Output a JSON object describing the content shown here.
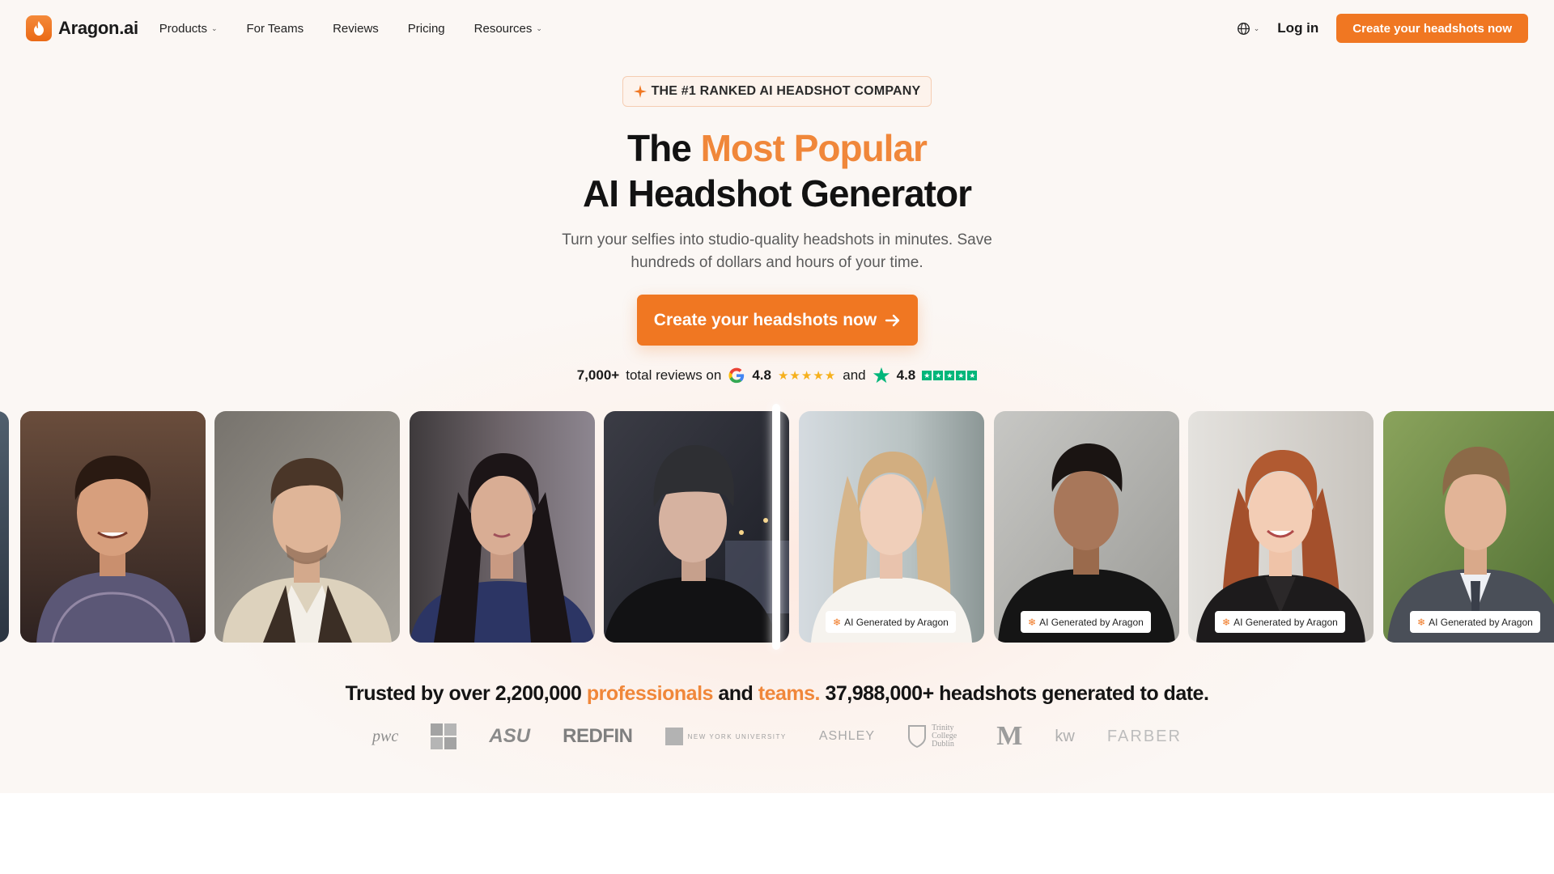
{
  "nav": {
    "logo_text": "Aragon.ai",
    "links": [
      {
        "label": "Products",
        "dropdown": true
      },
      {
        "label": "For Teams",
        "dropdown": false
      },
      {
        "label": "Reviews",
        "dropdown": false
      },
      {
        "label": "Pricing",
        "dropdown": false
      },
      {
        "label": "Resources",
        "dropdown": true
      }
    ],
    "login_label": "Log in",
    "cta_label": "Create your headshots now"
  },
  "hero": {
    "badge": "THE #1 RANKED AI HEADSHOT COMPANY",
    "title_part1": "The ",
    "title_accent": "Most Popular",
    "title_line2": "AI Headshot Generator",
    "subtitle": "Turn your selfies into studio-quality headshots in minutes. Save hundreds of dollars and hours of your time.",
    "cta_label": "Create your headshots now"
  },
  "reviews": {
    "count": "7,000+",
    "text": "total reviews on",
    "google_rating": "4.8",
    "and": "and",
    "trustpilot_rating": "4.8"
  },
  "carousel": {
    "ai_tag": "AI Generated by Aragon",
    "before_count": 4,
    "after_count": 4
  },
  "trust": {
    "prefix": "Trusted by over 2,200,000 ",
    "professionals": "professionals",
    "and": " and ",
    "teams": "teams.",
    "suffix": " 37,988,000+ headshots generated to date."
  },
  "brands": [
    "pwc",
    "REDFIN",
    "NEW YORK UNIVERSITY",
    "ASHLEY",
    "Trinity College Dublin",
    "FARBER"
  ],
  "colors": {
    "accent": "#f07722",
    "accent_light": "#f0873a",
    "google_star": "#f6b01c",
    "trustpilot": "#00b67a"
  }
}
